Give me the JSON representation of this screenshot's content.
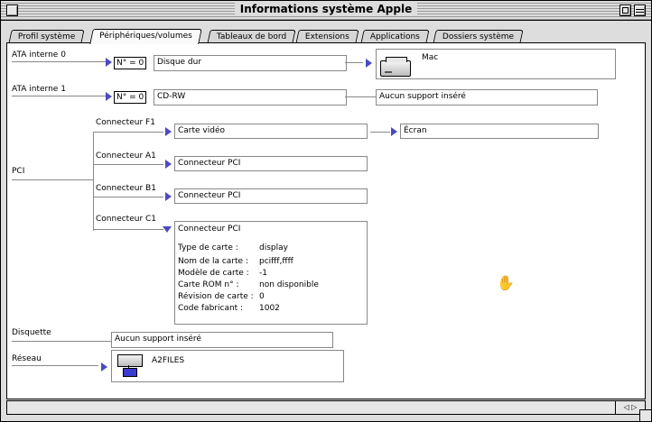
{
  "window": {
    "title": "Informations système Apple"
  },
  "tabs": [
    {
      "label": "Profil système"
    },
    {
      "label": "Périphériques/volumes"
    },
    {
      "label": "Tableaux de bord"
    },
    {
      "label": "Extensions"
    },
    {
      "label": "Applications"
    },
    {
      "label": "Dossiers système"
    }
  ],
  "ata0": {
    "label": "ATA interne 0",
    "num": "N° = 0",
    "device": "Disque dur",
    "volume": "Mac"
  },
  "ata1": {
    "label": "ATA interne 1",
    "num": "N° = 0",
    "device": "CD-RW",
    "status": "Aucun support inséré"
  },
  "pci": {
    "label": "PCI",
    "f1": {
      "label": "Connecteur F1",
      "device": "Carte vidéo",
      "child": "Écran"
    },
    "a1": {
      "label": "Connecteur A1",
      "device": "Connecteur PCI"
    },
    "b1": {
      "label": "Connecteur B1",
      "device": "Connecteur PCI"
    },
    "c1": {
      "label": "Connecteur C1",
      "device": "Connecteur PCI",
      "details": [
        {
          "key": "Type de carte :",
          "value": "display"
        },
        {
          "key": "Nom de la carte :",
          "value": "pcifff,ffff"
        },
        {
          "key": "Modèle de carte :",
          "value": "-1"
        },
        {
          "key": "Carte ROM n° :",
          "value": "non disponible"
        },
        {
          "key": "Révision de carte :",
          "value": "0"
        },
        {
          "key": "Code fabricant :",
          "value": "1002"
        }
      ]
    }
  },
  "floppy": {
    "label": "Disquette",
    "status": "Aucun support inséré"
  },
  "network": {
    "label": "Réseau",
    "volume": "A2FILES"
  },
  "icons": {
    "pointer": "hand-cursor-icon",
    "expanded": "disclosure-down-icon",
    "collapsed": "disclosure-right-icon"
  }
}
